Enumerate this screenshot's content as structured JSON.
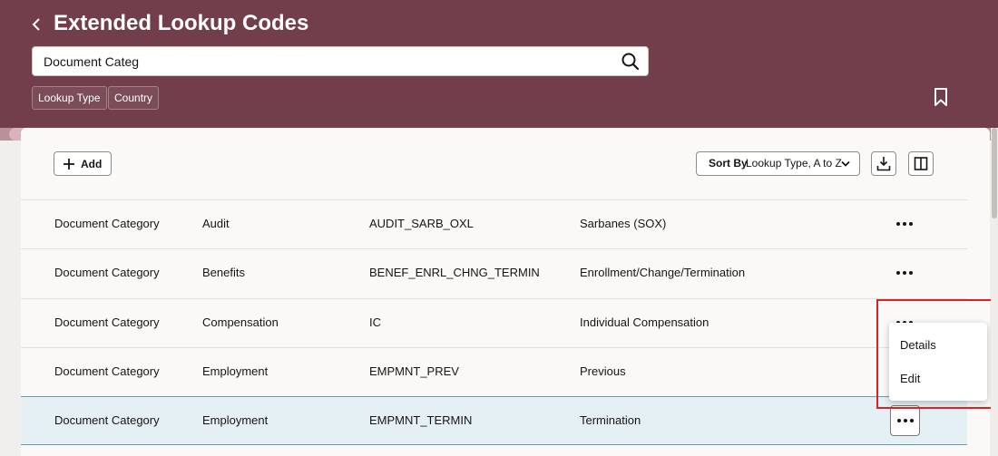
{
  "colors": {
    "header_bg": "#713e4a",
    "selected_row": "#e5f0f4",
    "selection_border": "#5f9fb3",
    "highlight_box": "#e02020"
  },
  "header": {
    "title": "Extended Lookup Codes",
    "back_icon": "chevron-left-icon",
    "bookmark_icon": "bookmark-icon"
  },
  "search": {
    "value": "Document Categ",
    "placeholder": "",
    "icon": "search-icon"
  },
  "filters": [
    {
      "label": "Lookup Type"
    },
    {
      "label": "Country"
    }
  ],
  "toolbar": {
    "add_label": "Add",
    "add_icon": "plus-icon",
    "sort_prefix": "Sort By",
    "sort_value": "Lookup Type, A to Z",
    "sort_icon": "chevron-down-icon",
    "export_icon": "download-icon",
    "columns_icon": "columns-icon"
  },
  "rows": [
    {
      "category": "Document Category",
      "type": "Audit",
      "code": "AUDIT_SARB_OXL",
      "meaning": "Sarbanes (SOX)",
      "selected": false
    },
    {
      "category": "Document Category",
      "type": "Benefits",
      "code": "BENEF_ENRL_CHNG_TERMIN",
      "meaning": "Enrollment/Change/Termination",
      "selected": false
    },
    {
      "category": "Document Category",
      "type": "Compensation",
      "code": "IC",
      "meaning": "Individual Compensation",
      "selected": false
    },
    {
      "category": "Document Category",
      "type": "Employment",
      "code": "EMPMNT_PREV",
      "meaning": "Previous",
      "selected": false
    },
    {
      "category": "Document Category",
      "type": "Employment",
      "code": "EMPMNT_TERMIN",
      "meaning": "Termination",
      "selected": true
    }
  ],
  "row_action_icon": "more-horizontal-icon",
  "context_menu": {
    "items": [
      "Details",
      "Edit"
    ]
  }
}
